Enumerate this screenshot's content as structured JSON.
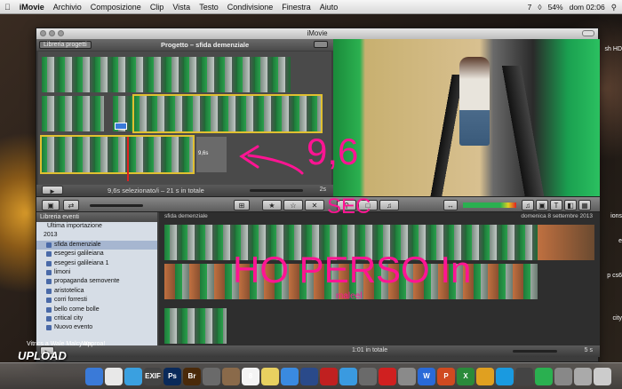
{
  "menubar": {
    "app": "iMovie",
    "items": [
      "Archivio",
      "Composizione",
      "Clip",
      "Vista",
      "Testo",
      "Condivisione",
      "Finestra",
      "Aiuto"
    ],
    "battery": "54%",
    "clock": "dom 02:06",
    "badge": "7"
  },
  "window": {
    "title": "iMovie"
  },
  "project": {
    "library_button": "Libreria progetti",
    "title": "Progetto – sfida demenziale",
    "status": "9,6s selezionato/i – 21 s in totale",
    "zoom_value": "2s",
    "clip_duration": "9,6s"
  },
  "events": {
    "header": "Libreria eventi",
    "items": [
      {
        "label": "Ultima importazione",
        "kind": "top"
      },
      {
        "label": "2013",
        "kind": "year"
      },
      {
        "label": "sfida demenziale",
        "kind": "event",
        "selected": true
      },
      {
        "label": "esegesi galileiana",
        "kind": "event"
      },
      {
        "label": "esegesi galileiana 1",
        "kind": "event"
      },
      {
        "label": "limoni",
        "kind": "event"
      },
      {
        "label": "propaganda semovente",
        "kind": "event"
      },
      {
        "label": "aristotelica",
        "kind": "event"
      },
      {
        "label": "corri forresti",
        "kind": "event"
      },
      {
        "label": "bello come bolle",
        "kind": "event"
      },
      {
        "label": "critical city",
        "kind": "event"
      },
      {
        "label": "Nuovo evento",
        "kind": "event"
      }
    ]
  },
  "browser": {
    "event_name": "sfida demenziale",
    "date": "domenica 8 settembre 2013",
    "total": "1:01 in totale",
    "zoom": "5 s"
  },
  "desktop": {
    "icons": [
      "sh HD",
      "ions",
      "e",
      "p cs6",
      "city"
    ],
    "watermark": "Vitrics a Wale Malcy approa!",
    "upload_logo": "UPLOAD",
    "war_label": "War"
  },
  "annotations": {
    "time": "9,6",
    "unit": "SEC",
    "lost": "HO PERSO In",
    "sub": "maleel"
  },
  "dock": {
    "apps": [
      {
        "label": "",
        "color": "#3a7ad8"
      },
      {
        "label": "",
        "color": "#e8e8e8"
      },
      {
        "label": "",
        "color": "#3aa0e0"
      },
      {
        "label": "EXIF",
        "color": "#444"
      },
      {
        "label": "Ps",
        "color": "#0a2a5a"
      },
      {
        "label": "Br",
        "color": "#4a2a0a"
      },
      {
        "label": "",
        "color": "#6a6a6a"
      },
      {
        "label": "",
        "color": "#8a6a4a"
      },
      {
        "label": "8",
        "color": "#f4f4f4"
      },
      {
        "label": "",
        "color": "#e8d060"
      },
      {
        "label": "",
        "color": "#3a8ae0"
      },
      {
        "label": "",
        "color": "#2a4a8a"
      },
      {
        "label": "",
        "color": "#c02020"
      },
      {
        "label": "",
        "color": "#3a9ae0"
      },
      {
        "label": "",
        "color": "#6a6a6a"
      },
      {
        "label": "",
        "color": "#d02020"
      },
      {
        "label": "",
        "color": "#8a8a8a"
      },
      {
        "label": "W",
        "color": "#2a6ad8"
      },
      {
        "label": "P",
        "color": "#d04a20"
      },
      {
        "label": "X",
        "color": "#2a8a3a"
      },
      {
        "label": "",
        "color": "#e0a020"
      },
      {
        "label": "",
        "color": "#1a9ae0"
      },
      {
        "label": "",
        "color": "#444"
      },
      {
        "label": "",
        "color": "#2ab050"
      },
      {
        "label": "",
        "color": "#888"
      },
      {
        "label": "",
        "color": "#aaa"
      },
      {
        "label": "",
        "color": "#ccc"
      }
    ]
  },
  "colors": {
    "annotation": "#ff1493",
    "selection": "#e0c030"
  }
}
